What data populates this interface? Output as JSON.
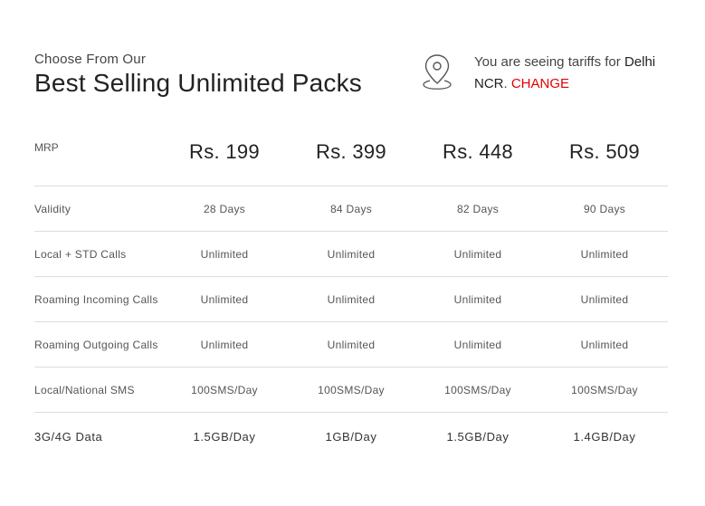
{
  "header": {
    "subtitle": "Choose From Our",
    "title": "Best Selling Unlimited Packs"
  },
  "location": {
    "icon": "map-pin-icon",
    "prefix": "You are seeing tariffs for ",
    "city_part1": "Delhi",
    "city_part2": "NCR",
    "separator": ". ",
    "change_label": "CHANGE",
    "accent_color": "#e60000"
  },
  "table": {
    "header_label": "MRP",
    "prices": [
      "Rs. 199",
      "Rs. 399",
      "Rs. 448",
      "Rs. 509"
    ],
    "rows": [
      {
        "label": "Validity",
        "values": [
          "28 Days",
          "84 Days",
          "82 Days",
          "90 Days"
        ]
      },
      {
        "label": "Local + STD Calls",
        "values": [
          "Unlimited",
          "Unlimited",
          "Unlimited",
          "Unlimited"
        ]
      },
      {
        "label": "Roaming Incoming Calls",
        "values": [
          "Unlimited",
          "Unlimited",
          "Unlimited",
          "Unlimited"
        ]
      },
      {
        "label": "Roaming Outgoing Calls",
        "values": [
          "Unlimited",
          "Unlimited",
          "Unlimited",
          "Unlimited"
        ]
      },
      {
        "label": "Local/National SMS",
        "values": [
          "100SMS/Day",
          "100SMS/Day",
          "100SMS/Day",
          "100SMS/Day"
        ]
      },
      {
        "label": "3G/4G Data",
        "values": [
          "1.5GB/Day",
          "1GB/Day",
          "1.5GB/Day",
          "1.4GB/Day"
        ]
      }
    ]
  }
}
